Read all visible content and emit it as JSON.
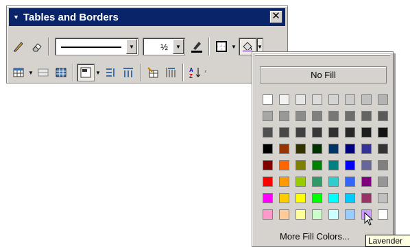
{
  "toolbar": {
    "title": "Tables and Borders",
    "close_glyph": "✕",
    "line_weight": "½",
    "row1_icons": [
      "draw-table-icon",
      "eraser-icon",
      "border-color-icon",
      "outside-border-icon",
      "shading-color-icon"
    ],
    "row2_icons": [
      "insert-table-icon",
      "merge-cells-icon",
      "split-cells-icon",
      "align-icon",
      "distribute-rows-icon",
      "distribute-columns-icon",
      "autoformat-icon",
      "autofit-icon",
      "sort-ascending-icon",
      "sort-descending-icon"
    ]
  },
  "palette": {
    "no_fill_label": "No Fill",
    "more_label": "More Fill Colors...",
    "rows": [
      [
        "#ffffff",
        "#f2f2f2",
        "#e6e6e6",
        "#dcdcdc",
        "#d4d4d4",
        "#cccccc",
        "#c0c0c0",
        "#b3b3b3"
      ],
      [
        "#a6a6a6",
        "#999999",
        "#8c8c8c",
        "#808080",
        "#777777",
        "#6e6e6e",
        "#646464",
        "#5a5a5a"
      ],
      [
        "#505050",
        "#484848",
        "#404040",
        "#383838",
        "#303030",
        "#282828",
        "#1e1e1e",
        "#141414"
      ],
      [
        "#000000",
        "#993300",
        "#333300",
        "#003300",
        "#003366",
        "#000080",
        "#333399",
        "#333333"
      ],
      [
        "#800000",
        "#ff6600",
        "#808000",
        "#008000",
        "#008080",
        "#0000ff",
        "#666699",
        "#808080"
      ],
      [
        "#ff0000",
        "#ff9900",
        "#99cc00",
        "#339966",
        "#33cccc",
        "#3366ff",
        "#800080",
        "#969696"
      ],
      [
        "#ff00ff",
        "#ffcc00",
        "#ffff00",
        "#00ff00",
        "#00ffff",
        "#00ccff",
        "#993366",
        "#c0c0c0"
      ],
      [
        "#ff99cc",
        "#ffcc99",
        "#ffff99",
        "#ccffcc",
        "#ccffff",
        "#99ccff",
        "#cc99ff",
        "#ffffff"
      ]
    ],
    "tooltip": "Lavender"
  }
}
